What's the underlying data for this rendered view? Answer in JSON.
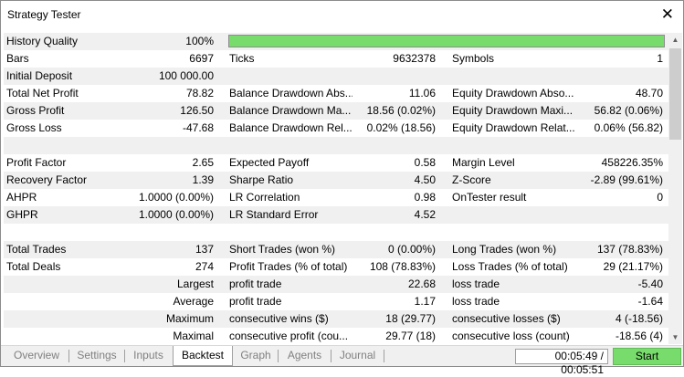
{
  "window": {
    "title": "Strategy Tester",
    "close_glyph": "✕"
  },
  "quality": {
    "label": "History Quality",
    "value": "100%",
    "fraction": 1.0,
    "color": "#77dc6b"
  },
  "rows": {
    "r1": {
      "l1": "Bars",
      "v1": "6697",
      "l2": "Ticks",
      "v2": "9632378",
      "l3": "Symbols",
      "v3": "1"
    },
    "r2": {
      "l1": "Initial Deposit",
      "v1": "100 000.00",
      "l2": "",
      "v2": "",
      "l3": "",
      "v3": ""
    },
    "r3": {
      "l1": "Total Net Profit",
      "v1": "78.82",
      "l2": "Balance Drawdown Abs...",
      "v2": "11.06",
      "l3": "Equity Drawdown Abso...",
      "v3": "48.70"
    },
    "r4": {
      "l1": "Gross Profit",
      "v1": "126.50",
      "l2": "Balance Drawdown Ma...",
      "v2": "18.56 (0.02%)",
      "l3": "Equity Drawdown Maxi...",
      "v3": "56.82 (0.06%)"
    },
    "r5": {
      "l1": "Gross Loss",
      "v1": "-47.68",
      "l2": "Balance Drawdown Rel...",
      "v2": "0.02% (18.56)",
      "l3": "Equity Drawdown Relat...",
      "v3": "0.06% (56.82)"
    },
    "r7": {
      "l1": "Profit Factor",
      "v1": "2.65",
      "l2": "Expected Payoff",
      "v2": "0.58",
      "l3": "Margin Level",
      "v3": "458226.35%"
    },
    "r8": {
      "l1": "Recovery Factor",
      "v1": "1.39",
      "l2": "Sharpe Ratio",
      "v2": "4.50",
      "l3": "Z-Score",
      "v3": "-2.89 (99.61%)"
    },
    "r9": {
      "l1": "AHPR",
      "v1": "1.0000 (0.00%)",
      "l2": "LR Correlation",
      "v2": "0.98",
      "l3": "OnTester result",
      "v3": "0"
    },
    "r10": {
      "l1": "GHPR",
      "v1": "1.0000 (0.00%)",
      "l2": "LR Standard Error",
      "v2": "4.52",
      "l3": "",
      "v3": ""
    },
    "r12": {
      "l1": "Total Trades",
      "v1": "137",
      "l2": "Short Trades (won %)",
      "v2": "0 (0.00%)",
      "l3": "Long Trades (won %)",
      "v3": "137 (78.83%)"
    },
    "r13": {
      "l1": "Total Deals",
      "v1": "274",
      "l2": "Profit Trades (% of total)",
      "v2": "108 (78.83%)",
      "l3": "Loss Trades (% of total)",
      "v3": "29 (21.17%)"
    },
    "r14": {
      "l1": "Largest",
      "l2": "profit trade",
      "v2": "22.68",
      "l3": "loss trade",
      "v3": "-5.40"
    },
    "r15": {
      "l1": "Average",
      "l2": "profit trade",
      "v2": "1.17",
      "l3": "loss trade",
      "v3": "-1.64"
    },
    "r16": {
      "l1": "Maximum",
      "l2": "consecutive wins ($)",
      "v2": "18 (29.77)",
      "l3": "consecutive losses ($)",
      "v3": "4 (-18.56)"
    },
    "r17": {
      "l1": "Maximal",
      "l2": "consecutive profit (cou...",
      "v2": "29.77 (18)",
      "l3": "consecutive loss (count)",
      "v3": "-18.56 (4)"
    }
  },
  "tabs": {
    "overview": "Overview",
    "settings": "Settings",
    "inputs": "Inputs",
    "backtest": "Backtest",
    "graph": "Graph",
    "agents": "Agents",
    "journal": "Journal",
    "active": "backtest"
  },
  "status": {
    "timer": "00:05:49 / 00:05:51"
  },
  "start_button": {
    "label": "Start",
    "color": "#77dc6b"
  },
  "icons": {
    "scroll_up": "chevron-up-icon",
    "scroll_down": "chevron-down-icon",
    "close": "close-icon"
  }
}
